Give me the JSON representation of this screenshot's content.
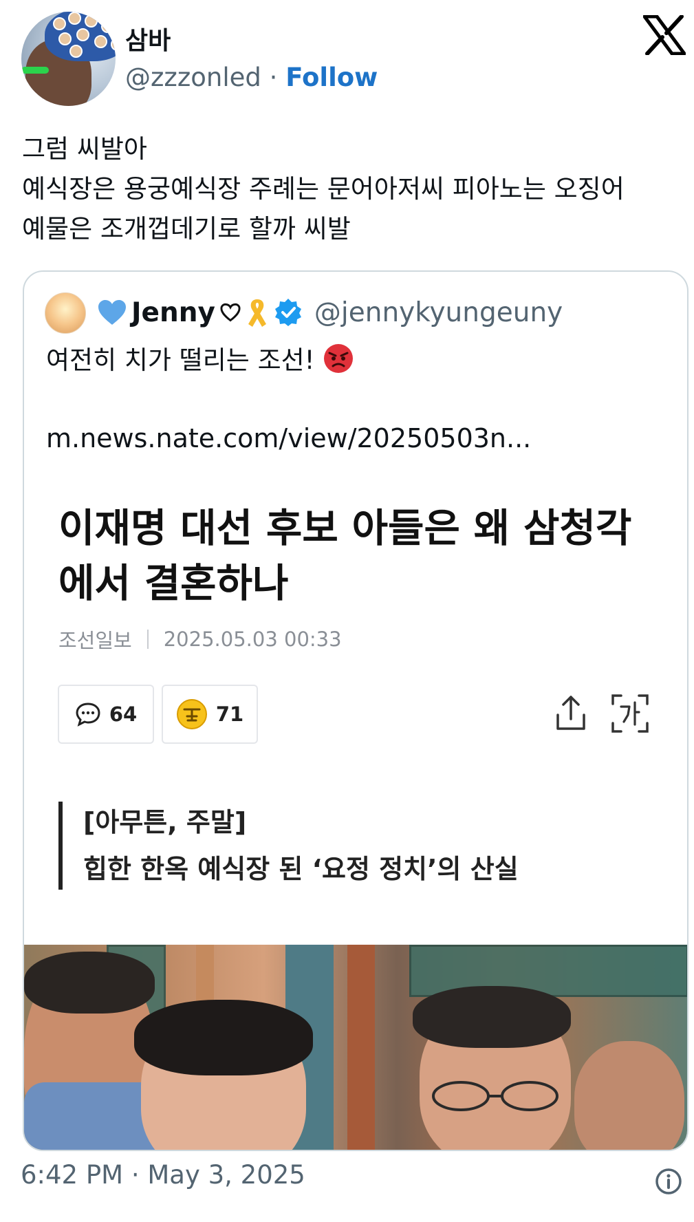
{
  "author": {
    "display_name": "삼바",
    "handle": "@zzzonled",
    "separator": "·",
    "follow_label": "Follow",
    "avatar_icon": "user-avatar"
  },
  "tweet": {
    "lines": [
      "그럼 씨발아",
      "예식장은 용궁예식장 주례는 문어아저씨 피아노는 오징어",
      "예물은 조개껍데기로 할까 씨발"
    ],
    "timestamp": "6:42 PM · May 3, 2025"
  },
  "quoted": {
    "display_name": "Jenny",
    "handle": "@jennykyungeuny",
    "text": "여전히 치가 떨리는 조선!",
    "link": "m.news.nate.com/view/20250503n...",
    "icons": [
      "blue-heart-icon",
      "white-heart-icon",
      "yellow-ribbon-icon",
      "verified-badge-icon",
      "angry-face-icon"
    ],
    "article": {
      "headline_lines": [
        "이재명 대선 후보 아들은 왜 삼청각",
        "에서 결혼하나"
      ],
      "source": "조선일보",
      "datetime": "2025.05.03 00:33",
      "comments_count": "64",
      "reactions_count": "71",
      "subtitle_lines": [
        "[아무튼, 주말]",
        "힙한 한옥 예식장 된 ‘요정 정치’의 산실"
      ]
    }
  },
  "colors": {
    "accent": "#1d73c8",
    "secondary_text": "#536471",
    "verified": "#1d9bf0",
    "border": "#cfd9de"
  }
}
